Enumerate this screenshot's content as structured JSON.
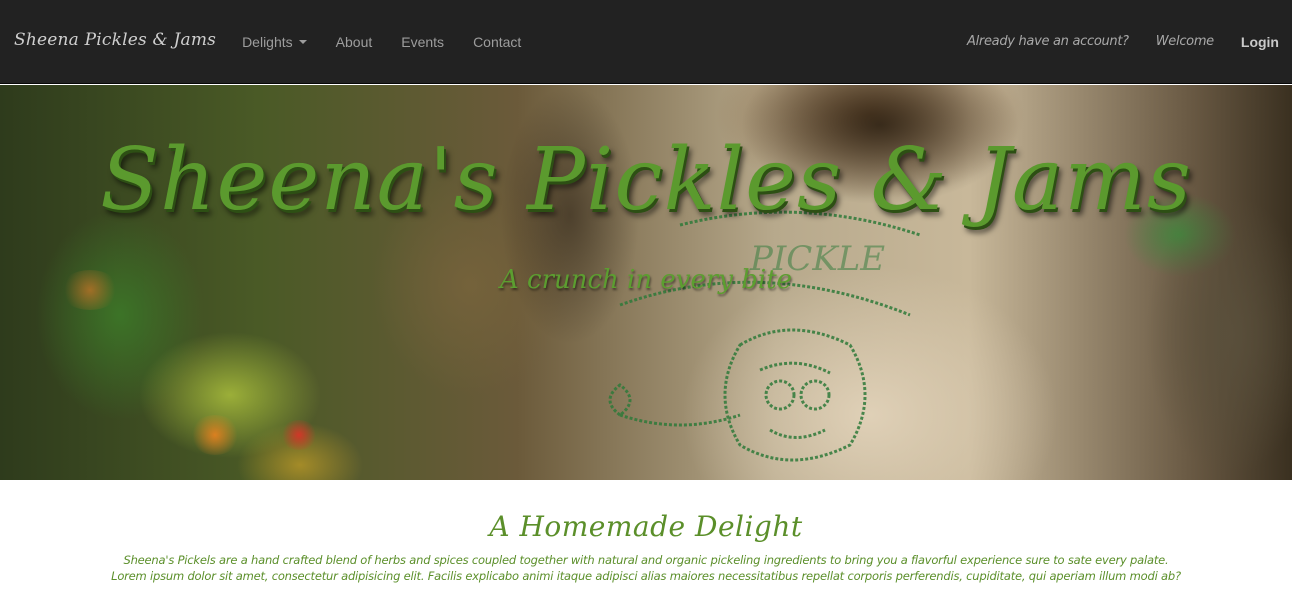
{
  "navbar": {
    "brand": "Sheena Pickles & Jams",
    "items": [
      {
        "label": "Delights",
        "dropdown": true
      },
      {
        "label": "About"
      },
      {
        "label": "Events"
      },
      {
        "label": "Contact"
      }
    ],
    "right": {
      "account_prompt": "Already have an account?",
      "welcome": "Welcome",
      "login": "Login"
    }
  },
  "hero": {
    "title": "Sheena's Pickles & Jams",
    "subtitle": "A crunch in every bite"
  },
  "content": {
    "heading": "A Homemade Delight",
    "line1": "Sheena's Pickels are a hand crafted blend of herbs and spices coupled together with natural and organic pickeling ingredients to bring you a flavorful experience sure to sate every palate.",
    "line2": "Lorem ipsum dolor sit amet, consectetur adipisicing elit. Facilis explicabo animi itaque adipisci alias maiores necessitatibus repellat corporis perferendis, cupiditate, qui aperiam illum modi ab?"
  },
  "colors": {
    "navbar_bg": "#222222",
    "accent_green": "#5b9a2e"
  }
}
